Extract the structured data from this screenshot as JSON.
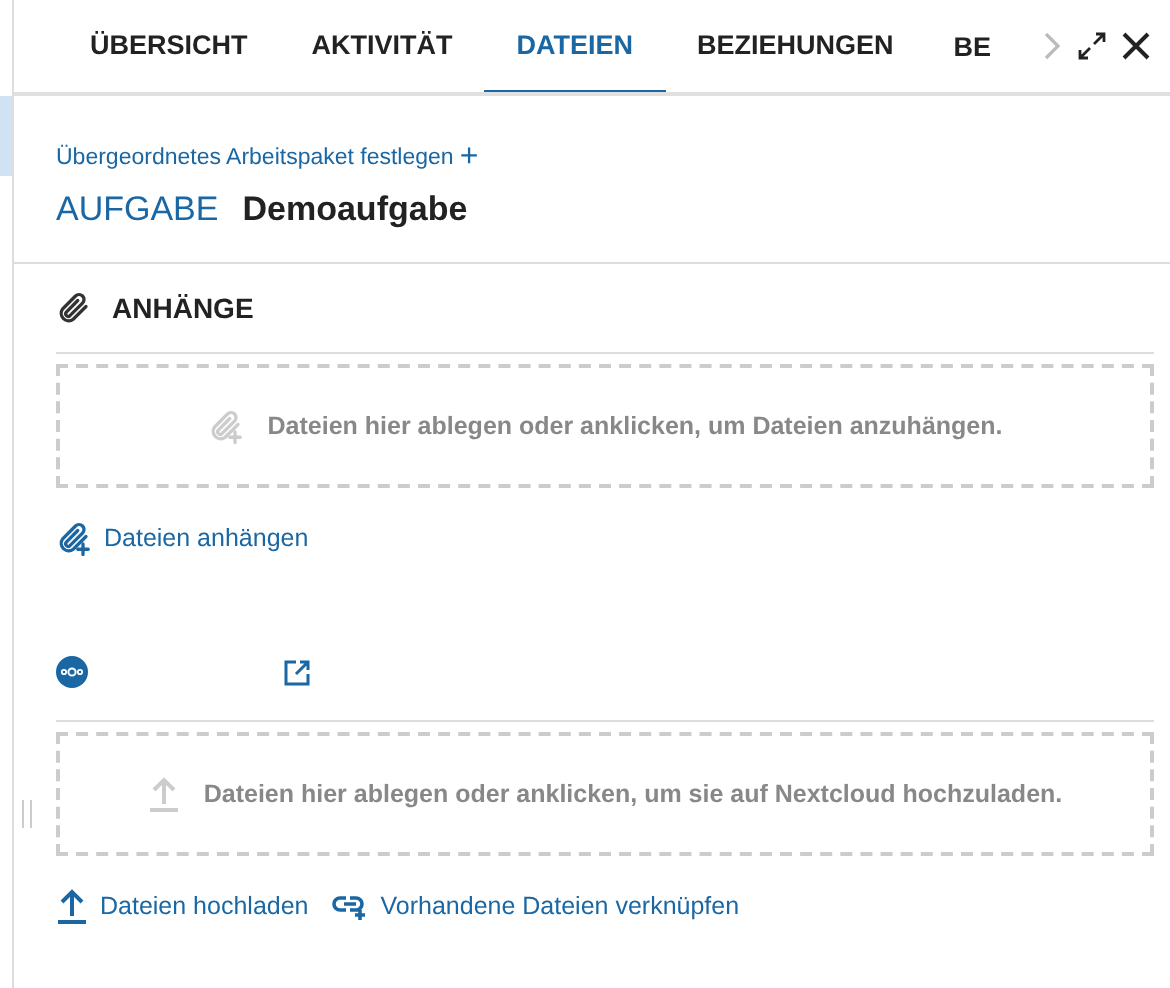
{
  "tabs": [
    {
      "label": "ÜBERSICHT",
      "selected": false
    },
    {
      "label": "AKTIVITÄT",
      "selected": false
    },
    {
      "label": "DATEIEN",
      "selected": true
    },
    {
      "label": "BEZIEHUNGEN",
      "selected": false
    },
    {
      "label": "BE",
      "selected": false
    }
  ],
  "parent_link": {
    "label": "Übergeordnetes Arbeitspaket festlegen",
    "icon": "+"
  },
  "work_package": {
    "type": "AUFGABE",
    "subject": "Demoaufgabe"
  },
  "attachments": {
    "title": "ANHÄNGE",
    "dropzone": "Dateien hier ablegen oder anklicken, um Dateien anzuhängen.",
    "action": "Dateien anhängen"
  },
  "nextcloud": {
    "dropzone": "Dateien hier ablegen oder anklicken, um sie auf Nextcloud hochzuladen.",
    "actions": [
      {
        "kind": "upload",
        "label": "Dateien hochladen"
      },
      {
        "kind": "link",
        "label": "Vorhandene Dateien verknüpfen"
      }
    ]
  }
}
